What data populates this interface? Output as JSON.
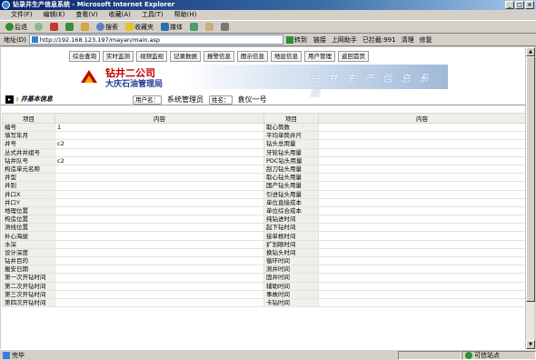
{
  "window": {
    "title": "钻录井生产信息系统 - Microsoft Internet Explorer",
    "controls": [
      "_",
      "□",
      "×"
    ]
  },
  "menu": [
    "文件(F)",
    "编辑(E)",
    "查看(V)",
    "收藏(A)",
    "工具(T)",
    "帮助(H)"
  ],
  "toolbar": {
    "back": "后退",
    "search": "搜索",
    "favorites": "收藏夹",
    "media": "媒体"
  },
  "address": {
    "label": "地址(D)",
    "url": "http://192.168.123.197/mayan/main.asp",
    "go": "转到",
    "links": "链接",
    "online": "上网助手",
    "blocked": "已拦截:991",
    "clean": "清理",
    "repair": "修复"
  },
  "nav": [
    "综合查询",
    "实时监测",
    "视频监视",
    "记录数据",
    "报警信息",
    "图示信息",
    "地层信息",
    "用户管理",
    "返回首页"
  ],
  "banner": {
    "company": "钻井二公司",
    "subtitle": "大庆石油管理局",
    "slogan": "钻井生产信息系统"
  },
  "info": {
    "section": "井基本信息",
    "user_label": "用户名：",
    "user_value": "系统管理员",
    "name_label": "姓名：",
    "name_value": "袁仪一号"
  },
  "table": {
    "headers": [
      "项目",
      "内容",
      "项目",
      "内容"
    ],
    "rows": [
      [
        "编号",
        "1",
        "取心筒数",
        ""
      ],
      [
        "填写年月",
        "",
        "平均单筒井尺",
        ""
      ],
      [
        "井号",
        "c2",
        "钻头总用量",
        ""
      ],
      [
        "丛式井井组号",
        "",
        "牙轮钻头用量",
        ""
      ],
      [
        "钻井队号",
        "c2",
        "PDC钻头用量",
        ""
      ],
      [
        "构造单元名称",
        "",
        "刮刀钻头用量",
        ""
      ],
      [
        "井型",
        "",
        "取心钻头用量",
        ""
      ],
      [
        "井别",
        "",
        "国产钻头用量",
        ""
      ],
      [
        "井口X",
        "",
        "引进钻头用量",
        ""
      ],
      [
        "井口Y",
        "",
        "单位直接成本",
        ""
      ],
      [
        "地理位置",
        "",
        "单位综合成本",
        ""
      ],
      [
        "构造位置",
        "",
        "纯钻进时间",
        ""
      ],
      [
        "测线位置",
        "",
        "起下钻时间",
        ""
      ],
      [
        "补心海拔",
        "",
        "接单根时间",
        ""
      ],
      [
        "水深",
        "",
        "扩划眼时间",
        ""
      ],
      [
        "设计深度",
        "",
        "换钻头时间",
        ""
      ],
      [
        "钻井目的",
        "",
        "循环时间",
        ""
      ],
      [
        "搬安日期",
        "",
        "测井时间",
        ""
      ],
      [
        "第一次开钻时间",
        "",
        "固井时间",
        ""
      ],
      [
        "第二次开钻时间",
        "",
        "辅助时间",
        ""
      ],
      [
        "第三次开钻时间",
        "",
        "事故时间",
        ""
      ],
      [
        "第四次开钻时间",
        "",
        "卡钻时间",
        ""
      ]
    ]
  },
  "status": {
    "left": "完毕",
    "zone": "可信站点"
  },
  "icons": [
    "ie-icon",
    "back-arrow-icon",
    "forward-arrow-icon",
    "stop-icon",
    "refresh-icon",
    "home-icon",
    "search-icon",
    "favorites-star-icon",
    "media-icon",
    "history-icon",
    "mail-icon",
    "print-icon",
    "go-arrow-icon",
    "page-icon",
    "shield-icon"
  ]
}
